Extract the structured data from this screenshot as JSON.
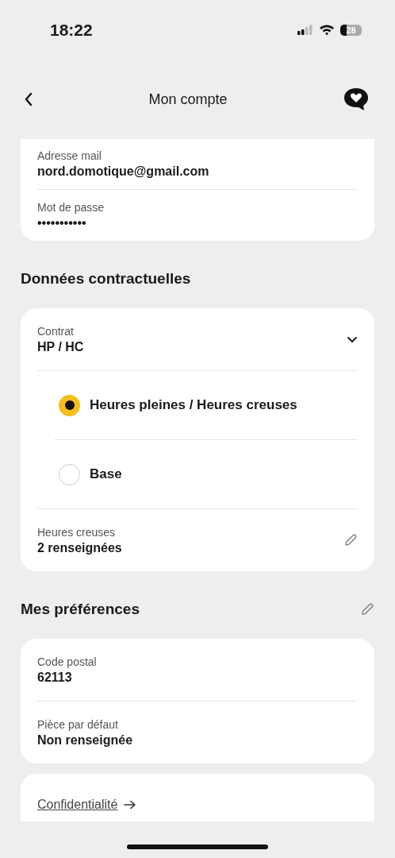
{
  "status_bar": {
    "time": "18:22",
    "battery": "28"
  },
  "header": {
    "title": "Mon compte"
  },
  "account": [
    {
      "label": "Adresse mail",
      "value": "nord.domotique@gmail.com"
    },
    {
      "label": "Mot de passe",
      "value": "•••••••••••"
    }
  ],
  "contract_section": {
    "title": "Données contractuelles",
    "contract": {
      "label": "Contrat",
      "value": "HP / HC",
      "expanded": true
    },
    "options": [
      {
        "label": "Heures pleines / Heures creuses",
        "selected": true
      },
      {
        "label": "Base",
        "selected": false
      }
    ],
    "off_peak": {
      "label": "Heures creuses",
      "value": "2 renseignées"
    }
  },
  "preferences": {
    "title": "Mes préférences",
    "items": [
      {
        "label": "Code postal",
        "value": "62113"
      },
      {
        "label": "Pièce par défaut",
        "value": "Non renseignée"
      }
    ]
  },
  "links": [
    {
      "label": "Confidentialité"
    }
  ]
}
